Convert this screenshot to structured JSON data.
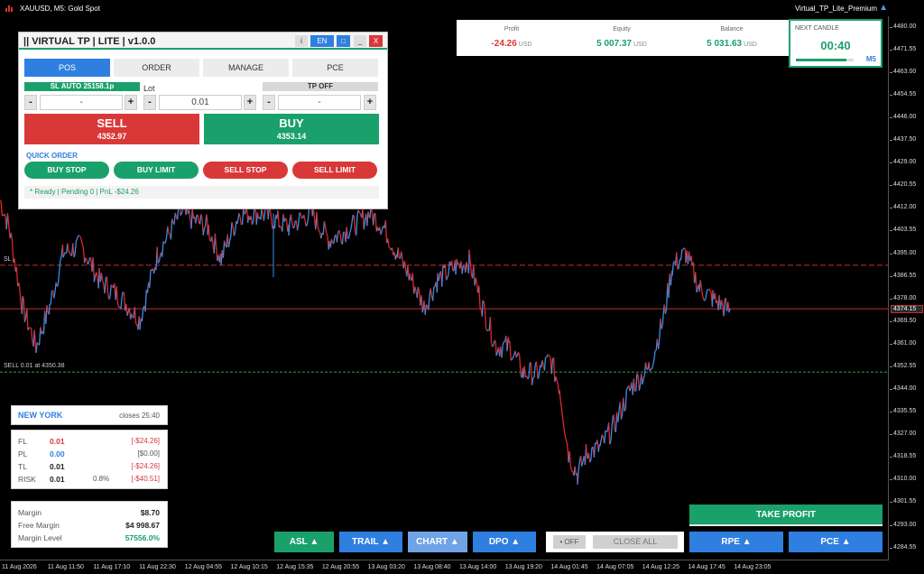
{
  "window": {
    "symbol_title": "XAUUSD, M5:  Gold Spot",
    "ea_title": "Virtual_TP_Lite_Premium"
  },
  "panel": {
    "title": "|| VIRTUAL TP | LITE | v1.0.0",
    "header_buttons": [
      "i",
      "EN",
      "□",
      "_",
      "X"
    ],
    "tabs": [
      "POS",
      "ORDER",
      "MANAGE",
      "PCE"
    ],
    "active_tab": "POS",
    "sl_label": "SL AUTO 25158.1p",
    "lot_label": "Lot",
    "tp_label": "TP  OFF",
    "sl_value": "-",
    "lot_value": "0.01",
    "tp_value": "-",
    "minus": "-",
    "plus": "+",
    "sell_label": "SELL",
    "sell_price": "4352.97",
    "buy_label": "BUY",
    "buy_price": "4353.14",
    "quick_order_label": "QUICK ORDER",
    "quick_orders": [
      "BUY STOP",
      "BUY LIMIT",
      "SELL STOP",
      "SELL LIMIT"
    ],
    "status": "* Ready    |    Pending 0    |    PnL -$24.26"
  },
  "stats": {
    "profit_label": "Profit",
    "profit_value": "-24.26",
    "equity_label": "Equity",
    "equity_value": "5 007.37",
    "balance_label": "Balance",
    "balance_value": "5 031.63",
    "unit": "USD",
    "colors": {
      "negative": "#d93838",
      "positive": "#1aa06a"
    }
  },
  "next_candle": {
    "label": "NEXT CANDLE",
    "time": "00:40",
    "timeframe": "M5",
    "progress": 0.87
  },
  "session": {
    "name": "NEW YORK",
    "closes": "closes 25:40"
  },
  "pnl": {
    "rows": [
      {
        "key": "FL",
        "value": "0.01",
        "pct": "",
        "bracket": "[-$24.26]",
        "value_color": "#d93838",
        "bracket_color": "#d93838"
      },
      {
        "key": "PL",
        "value": "0.00",
        "pct": "",
        "bracket": "[$0.00]",
        "value_color": "#2f7fe0",
        "bracket_color": "#555555"
      },
      {
        "key": "TL",
        "value": "0.01",
        "pct": "",
        "bracket": "[-$24.26]",
        "value_color": "#222222",
        "bracket_color": "#d93838"
      },
      {
        "key": "RISK",
        "value": "0.01",
        "pct": "0.8%",
        "bracket": "[-$40.51]",
        "value_color": "#222222",
        "bracket_color": "#d93838"
      }
    ]
  },
  "margin": {
    "rows": [
      {
        "key": "Margin",
        "value": "$8.70",
        "color": "#222222"
      },
      {
        "key": "Free Margin",
        "value": "$4 998.67",
        "color": "#222222"
      },
      {
        "key": "Margin Level",
        "value": "57556.0%",
        "color": "#1aa06a"
      }
    ]
  },
  "buttons": {
    "asl": "ASL ▲",
    "trail": "TRAIL ▲",
    "chart": "CHART ▲",
    "dpo": "DPO  ▲",
    "off": "• OFF",
    "close_all": "CLOSE ALL",
    "rpe": "RPE  ▲",
    "pce": "PCE  ▲",
    "take_profit": "TAKE PROFIT"
  },
  "chart_lines": {
    "sl_label": "SL",
    "sell_label": "SELL 0.01 at 4350.38",
    "current_price": "4374.15"
  },
  "chart_data": {
    "type": "line",
    "ylim": [
      4280,
      4484
    ],
    "price_ticks": [
      "4480.00",
      "4471.55",
      "4463.00",
      "4454.55",
      "4446.00",
      "4437.50",
      "4429.00",
      "4420.55",
      "4412.00",
      "4403.55",
      "4395.00",
      "4386.55",
      "4378.00",
      "4369.50",
      "4361.00",
      "4352.55",
      "4344.00",
      "4335.55",
      "4327.00",
      "4318.55",
      "4310.00",
      "4301.55",
      "4293.00",
      "4284.55"
    ],
    "time_ticks": [
      "11 Aug 2026",
      "11 Aug 11:50",
      "11 Aug 17:10",
      "11 Aug 22:30",
      "12 Aug 04:55",
      "12 Aug 10:15",
      "12 Aug 15:35",
      "12 Aug 20:55",
      "13 Aug 03:20",
      "13 Aug 08:40",
      "13 Aug 14:00",
      "13 Aug 19:20",
      "14 Aug 01:45",
      "14 Aug 07:05",
      "14 Aug 12:25",
      "14 Aug 17:45",
      "14 Aug 23:05"
    ],
    "sl_level": 4390.5,
    "sell_level": 4350.38,
    "current_level": 4374.15,
    "colors": {
      "up": "#3a8ee6",
      "down": "#e02828",
      "sl": "#c03030",
      "sell": "#2aa04a",
      "current": "#c03030"
    },
    "keypoints": [
      [
        0,
        4415
      ],
      [
        10,
        4405
      ],
      [
        25,
        4375
      ],
      [
        40,
        4360
      ],
      [
        55,
        4375
      ],
      [
        70,
        4395
      ],
      [
        90,
        4398
      ],
      [
        110,
        4385
      ],
      [
        135,
        4378
      ],
      [
        155,
        4370
      ],
      [
        175,
        4395
      ],
      [
        200,
        4410
      ],
      [
        230,
        4405
      ],
      [
        245,
        4393
      ],
      [
        265,
        4410
      ],
      [
        290,
        4410
      ],
      [
        320,
        4405
      ],
      [
        345,
        4410
      ],
      [
        365,
        4400
      ],
      [
        390,
        4405
      ],
      [
        410,
        4410
      ],
      [
        425,
        4405
      ],
      [
        440,
        4395
      ],
      [
        455,
        4386
      ],
      [
        470,
        4375
      ],
      [
        485,
        4385
      ],
      [
        505,
        4390
      ],
      [
        520,
        4392
      ],
      [
        535,
        4375
      ],
      [
        550,
        4360
      ],
      [
        565,
        4360
      ],
      [
        580,
        4350
      ],
      [
        595,
        4350
      ],
      [
        610,
        4355
      ],
      [
        620,
        4345
      ],
      [
        630,
        4320
      ],
      [
        640,
        4312
      ],
      [
        650,
        4320
      ],
      [
        665,
        4322
      ],
      [
        680,
        4330
      ],
      [
        700,
        4345
      ],
      [
        720,
        4352
      ],
      [
        735,
        4370
      ],
      [
        745,
        4390
      ],
      [
        760,
        4395
      ],
      [
        775,
        4382
      ],
      [
        790,
        4378
      ],
      [
        810,
        4373
      ]
    ]
  }
}
